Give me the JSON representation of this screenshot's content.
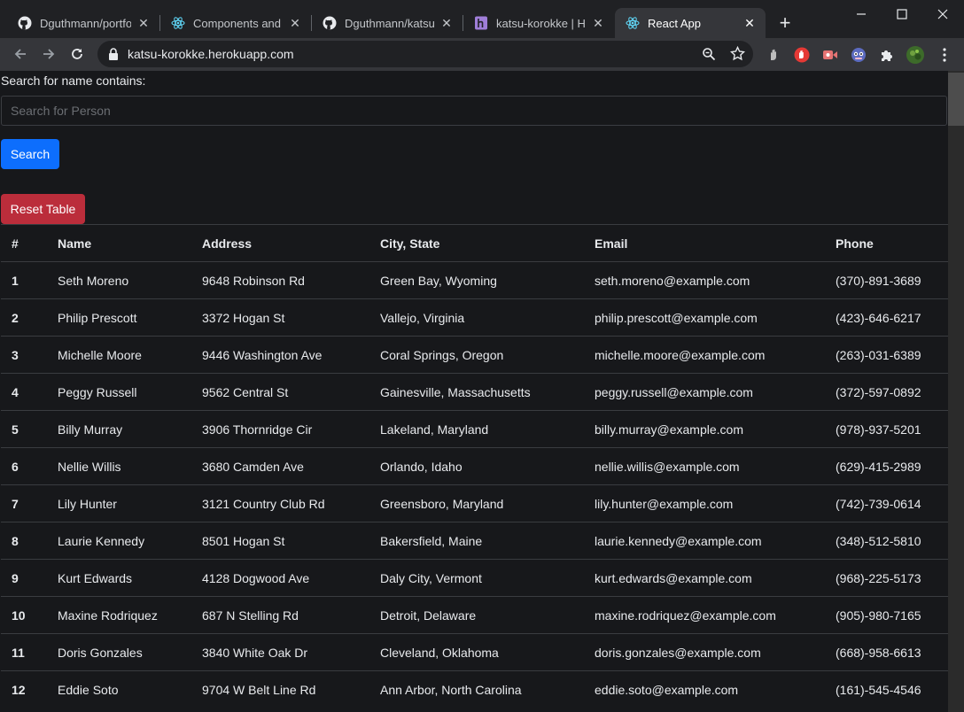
{
  "browser": {
    "tabs": [
      {
        "title": "Dguthmann/portfolio",
        "favicon": "github-icon"
      },
      {
        "title": "Components and Props",
        "favicon": "react-icon"
      },
      {
        "title": "Dguthmann/katsu-korokke",
        "favicon": "github-icon"
      },
      {
        "title": "katsu-korokke | Heroku",
        "favicon": "heroku-icon"
      },
      {
        "title": "React App",
        "favicon": "react-icon",
        "active": true
      }
    ],
    "url": "katsu-korokke.herokuapp.com"
  },
  "search": {
    "label": "Search for name contains:",
    "placeholder": "Search for Person",
    "value": "",
    "button_label": "Search"
  },
  "reset_label": "Reset Table",
  "table": {
    "columns": [
      "#",
      "Name",
      "Address",
      "City, State",
      "Email",
      "Phone"
    ],
    "rows": [
      [
        "1",
        "Seth Moreno",
        "9648 Robinson Rd",
        "Green Bay, Wyoming",
        "seth.moreno@example.com",
        "(370)-891-3689"
      ],
      [
        "2",
        "Philip Prescott",
        "3372 Hogan St",
        "Vallejo, Virginia",
        "philip.prescott@example.com",
        "(423)-646-6217"
      ],
      [
        "3",
        "Michelle Moore",
        "9446 Washington Ave",
        "Coral Springs, Oregon",
        "michelle.moore@example.com",
        "(263)-031-6389"
      ],
      [
        "4",
        "Peggy Russell",
        "9562 Central St",
        "Gainesville, Massachusetts",
        "peggy.russell@example.com",
        "(372)-597-0892"
      ],
      [
        "5",
        "Billy Murray",
        "3906 Thornridge Cir",
        "Lakeland, Maryland",
        "billy.murray@example.com",
        "(978)-937-5201"
      ],
      [
        "6",
        "Nellie Willis",
        "3680 Camden Ave",
        "Orlando, Idaho",
        "nellie.willis@example.com",
        "(629)-415-2989"
      ],
      [
        "7",
        "Lily Hunter",
        "3121 Country Club Rd",
        "Greensboro, Maryland",
        "lily.hunter@example.com",
        "(742)-739-0614"
      ],
      [
        "8",
        "Laurie Kennedy",
        "8501 Hogan St",
        "Bakersfield, Maine",
        "laurie.kennedy@example.com",
        "(348)-512-5810"
      ],
      [
        "9",
        "Kurt Edwards",
        "4128 Dogwood Ave",
        "Daly City, Vermont",
        "kurt.edwards@example.com",
        "(968)-225-5173"
      ],
      [
        "10",
        "Maxine Rodriquez",
        "687 N Stelling Rd",
        "Detroit, Delaware",
        "maxine.rodriquez@example.com",
        "(905)-980-7165"
      ],
      [
        "11",
        "Doris Gonzales",
        "3840 White Oak Dr",
        "Cleveland, Oklahoma",
        "doris.gonzales@example.com",
        "(668)-958-6613"
      ],
      [
        "12",
        "Eddie Soto",
        "9704 W Belt Line Rd",
        "Ann Arbor, North Carolina",
        "eddie.soto@example.com",
        "(161)-545-4546"
      ]
    ]
  },
  "colors": {
    "search_button": "#0d6efd",
    "reset_button": "#bb2d3b",
    "page_background": "#17181b"
  }
}
